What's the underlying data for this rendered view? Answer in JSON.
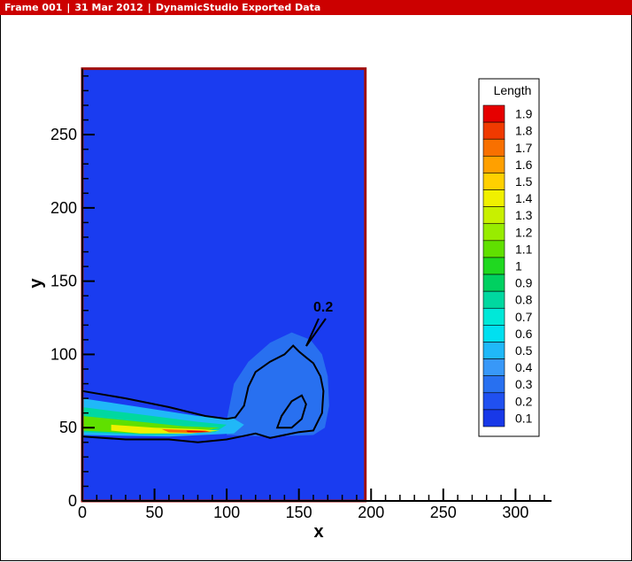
{
  "header": {
    "frame": "Frame 001",
    "date": "31 Mar 2012",
    "source": "DynamicStudio Exported Data"
  },
  "colors": {
    "title_bar": "#cc0000",
    "field_background": "#1a3cf0",
    "domain_border": "#a01010"
  },
  "chart_data": {
    "type": "heatmap",
    "title": "",
    "xlabel": "x",
    "ylabel": "y",
    "xlim": [
      0,
      325
    ],
    "ylim": [
      0,
      295
    ],
    "x_ticks": [
      0,
      50,
      100,
      150,
      200,
      250,
      300
    ],
    "y_ticks": [
      0,
      50,
      100,
      150,
      200,
      250
    ],
    "domain": {
      "x": [
        0,
        196
      ],
      "y": [
        0,
        295
      ]
    },
    "grid": false,
    "colorbar": {
      "title": "Length",
      "levels": [
        1.9,
        1.8,
        1.7,
        1.6,
        1.5,
        1.4,
        1.3,
        1.2,
        1.1,
        1,
        0.9,
        0.8,
        0.7,
        0.6,
        0.5,
        0.4,
        0.3,
        0.2,
        0.1
      ],
      "labels": [
        "1.9",
        "1.8",
        "1.7",
        "1.6",
        "1.5",
        "1.4",
        "1.3",
        "1.2",
        "1.1",
        "1",
        "0.9",
        "0.8",
        "0.7",
        "0.6",
        "0.5",
        "0.4",
        "0.3",
        "0.2",
        "0.1"
      ],
      "colors": [
        "#e60000",
        "#f03a00",
        "#f87000",
        "#ffa000",
        "#ffd000",
        "#f0f000",
        "#c8f000",
        "#98ec00",
        "#60e000",
        "#20d820",
        "#00d060",
        "#00d8a0",
        "#00e8d8",
        "#00e0f0",
        "#20b8f8",
        "#3898f8",
        "#2870f0",
        "#2050f0",
        "#1838e8"
      ]
    },
    "contour_label": "0.2",
    "contour_0_2": [
      [
        0,
        75
      ],
      [
        30,
        70
      ],
      [
        60,
        64
      ],
      [
        85,
        58
      ],
      [
        100,
        56
      ],
      [
        106,
        57
      ],
      [
        112,
        65
      ],
      [
        115,
        78
      ],
      [
        120,
        88
      ],
      [
        130,
        95
      ],
      [
        140,
        100
      ],
      [
        146,
        106
      ],
      [
        150,
        102
      ],
      [
        155,
        98
      ],
      [
        160,
        94
      ],
      [
        165,
        85
      ],
      [
        167,
        75
      ],
      [
        166,
        60
      ],
      [
        160,
        48
      ],
      [
        150,
        47
      ],
      [
        140,
        45
      ],
      [
        130,
        43
      ],
      [
        120,
        46
      ],
      [
        110,
        44
      ],
      [
        100,
        42
      ],
      [
        80,
        40
      ],
      [
        60,
        42
      ],
      [
        30,
        42
      ],
      [
        0,
        44
      ]
    ],
    "contour_0_2_inner": [
      [
        135,
        50
      ],
      [
        138,
        58
      ],
      [
        145,
        68
      ],
      [
        152,
        72
      ],
      [
        155,
        66
      ],
      [
        152,
        56
      ],
      [
        145,
        50
      ],
      [
        135,
        50
      ]
    ],
    "field_regions": [
      {
        "level": 0.25,
        "polygon": [
          [
            100,
            55
          ],
          [
            105,
            80
          ],
          [
            115,
            95
          ],
          [
            130,
            108
          ],
          [
            145,
            115
          ],
          [
            158,
            110
          ],
          [
            166,
            100
          ],
          [
            170,
            85
          ],
          [
            171,
            65
          ],
          [
            168,
            50
          ],
          [
            160,
            45
          ],
          [
            130,
            44
          ],
          [
            100,
            45
          ]
        ]
      },
      {
        "level": 0.35,
        "polygon": [
          [
            110,
            55
          ],
          [
            115,
            75
          ],
          [
            125,
            90
          ],
          [
            140,
            97
          ],
          [
            152,
            95
          ],
          [
            160,
            85
          ],
          [
            164,
            70
          ],
          [
            162,
            55
          ],
          [
            150,
            48
          ],
          [
            120,
            47
          ]
        ]
      },
      {
        "level": 0.5,
        "polygon": [
          [
            0,
            70
          ],
          [
            40,
            64
          ],
          [
            80,
            58
          ],
          [
            105,
            56
          ],
          [
            112,
            52
          ],
          [
            105,
            46
          ],
          [
            60,
            44
          ],
          [
            0,
            45
          ]
        ]
      },
      {
        "level": 0.8,
        "polygon": [
          [
            0,
            64
          ],
          [
            40,
            59
          ],
          [
            80,
            54
          ],
          [
            100,
            52
          ],
          [
            92,
            47
          ],
          [
            50,
            45
          ],
          [
            0,
            47
          ]
        ]
      },
      {
        "level": 1.1,
        "polygon": [
          [
            0,
            58
          ],
          [
            30,
            55
          ],
          [
            70,
            51
          ],
          [
            95,
            50
          ],
          [
            80,
            47
          ],
          [
            40,
            46
          ],
          [
            0,
            48
          ]
        ]
      },
      {
        "level": 1.4,
        "polygon": [
          [
            20,
            52
          ],
          [
            50,
            50
          ],
          [
            80,
            49
          ],
          [
            95,
            48
          ],
          [
            75,
            46
          ],
          [
            40,
            46
          ],
          [
            20,
            48
          ]
        ]
      },
      {
        "level": 1.7,
        "polygon": [
          [
            55,
            49
          ],
          [
            70,
            48.5
          ],
          [
            85,
            48
          ],
          [
            90,
            47
          ],
          [
            75,
            46.5
          ],
          [
            60,
            46.8
          ]
        ]
      },
      {
        "level": 1.9,
        "polygon": [
          [
            72,
            48
          ],
          [
            82,
            47.8
          ],
          [
            88,
            47.2
          ],
          [
            80,
            46.8
          ],
          [
            73,
            47
          ]
        ]
      }
    ]
  }
}
